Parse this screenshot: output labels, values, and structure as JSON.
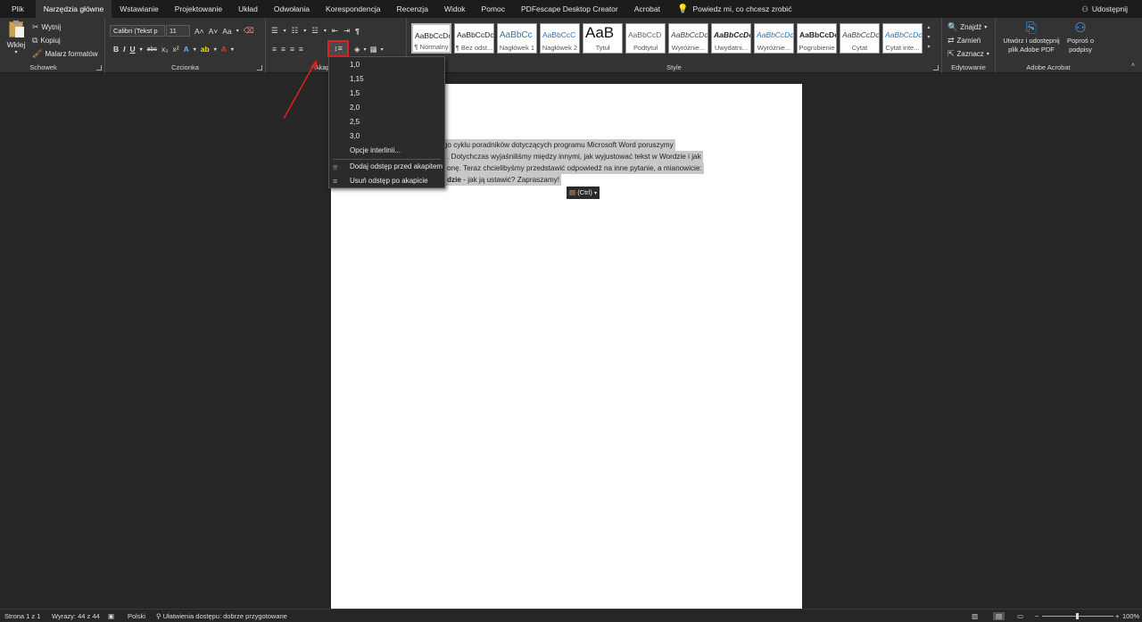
{
  "tabs": [
    "Plik",
    "Narzędzia główne",
    "Wstawianie",
    "Projektowanie",
    "Układ",
    "Odwołania",
    "Korespondencja",
    "Recenzja",
    "Widok",
    "Pomoc",
    "PDFescape Desktop Creator",
    "Acrobat"
  ],
  "tell_me": "Powiedz mi, co chcesz zrobić",
  "share": "Udostępnij",
  "clipboard": {
    "label": "Schowek",
    "paste": "Wklej",
    "cut": "Wytnij",
    "copy": "Kopiuj",
    "format_painter": "Malarz formatów"
  },
  "font": {
    "label": "Czcionka",
    "family": "Calibri (Tekst p",
    "size": "11",
    "bold": "B",
    "italic": "I",
    "underline": "U",
    "strike": "abc",
    "sub": "x₂",
    "sup": "x²",
    "change_case": "Aa"
  },
  "paragraph": {
    "label": "Akapit",
    "pilcrow": "¶"
  },
  "styles": {
    "label": "Style",
    "items": [
      {
        "preview": "AaBbCcDc",
        "name": "¶ Normalny"
      },
      {
        "preview": "AaBbCcDc",
        "name": "¶ Bez odst..."
      },
      {
        "preview": "AaBbCc",
        "name": "Nagłówek 1"
      },
      {
        "preview": "AaBbCcC",
        "name": "Nagłówek 2"
      },
      {
        "preview": "AaB",
        "name": "Tytuł"
      },
      {
        "preview": "AaBbCcD",
        "name": "Podtytuł"
      },
      {
        "preview": "AaBbCcDc",
        "name": "Wyróżnie..."
      },
      {
        "preview": "AaBbCcDc",
        "name": "Uwydatni..."
      },
      {
        "preview": "AaBbCcDc",
        "name": "Wyróżnie..."
      },
      {
        "preview": "AaBbCcDc",
        "name": "Pogrubienie"
      },
      {
        "preview": "AaBbCcDc",
        "name": "Cytat"
      },
      {
        "preview": "AaBbCcDc",
        "name": "Cytat inte..."
      }
    ]
  },
  "editing": {
    "label": "Edytowanie",
    "find": "Znajdź",
    "replace": "Zamień",
    "select": "Zaznacz"
  },
  "acrobat": {
    "label": "Adobe Acrobat",
    "create_line1": "Utwórz i udostępnij",
    "create_line2": "plik Adobe PDF",
    "sign_line1": "Poproś o",
    "sign_line2": "podpisy"
  },
  "line_spacing_menu": {
    "items": [
      "1,0",
      "1,15",
      "1,5",
      "2,0",
      "2,5",
      "3,0"
    ],
    "options": "Opcje interlinii...",
    "add_before": "Dodaj odstęp przed akapitem",
    "remove_after": "Usuń odstęp po akapicie"
  },
  "document": {
    "line1": "naszego cyklu poradników dotyczących programu Microsoft Word poruszymy",
    "line2": ". Dotychczas wyjaśniliśmy między innymi, jak wyjustować tekst w Wordzie i jak",
    "line3": "onę. Teraz chcielibyśmy przedstawić odpowiedź na inne pytanie, a mianowicie:",
    "line4_bold": "dzie",
    "line4_rest": " - jak ją ustawić? Zapraszamy!"
  },
  "paste_tag": "(Ctrl)",
  "status": {
    "page": "Strona 1 z 1",
    "words": "Wyrazy: 44 z 44",
    "language": "Polski",
    "accessibility": "Ułatwienia dostępu: dobrze przygotowane",
    "zoom": "100%"
  },
  "colors": {
    "accent_red": "#e02020",
    "highlight": "#c8c8c8"
  }
}
